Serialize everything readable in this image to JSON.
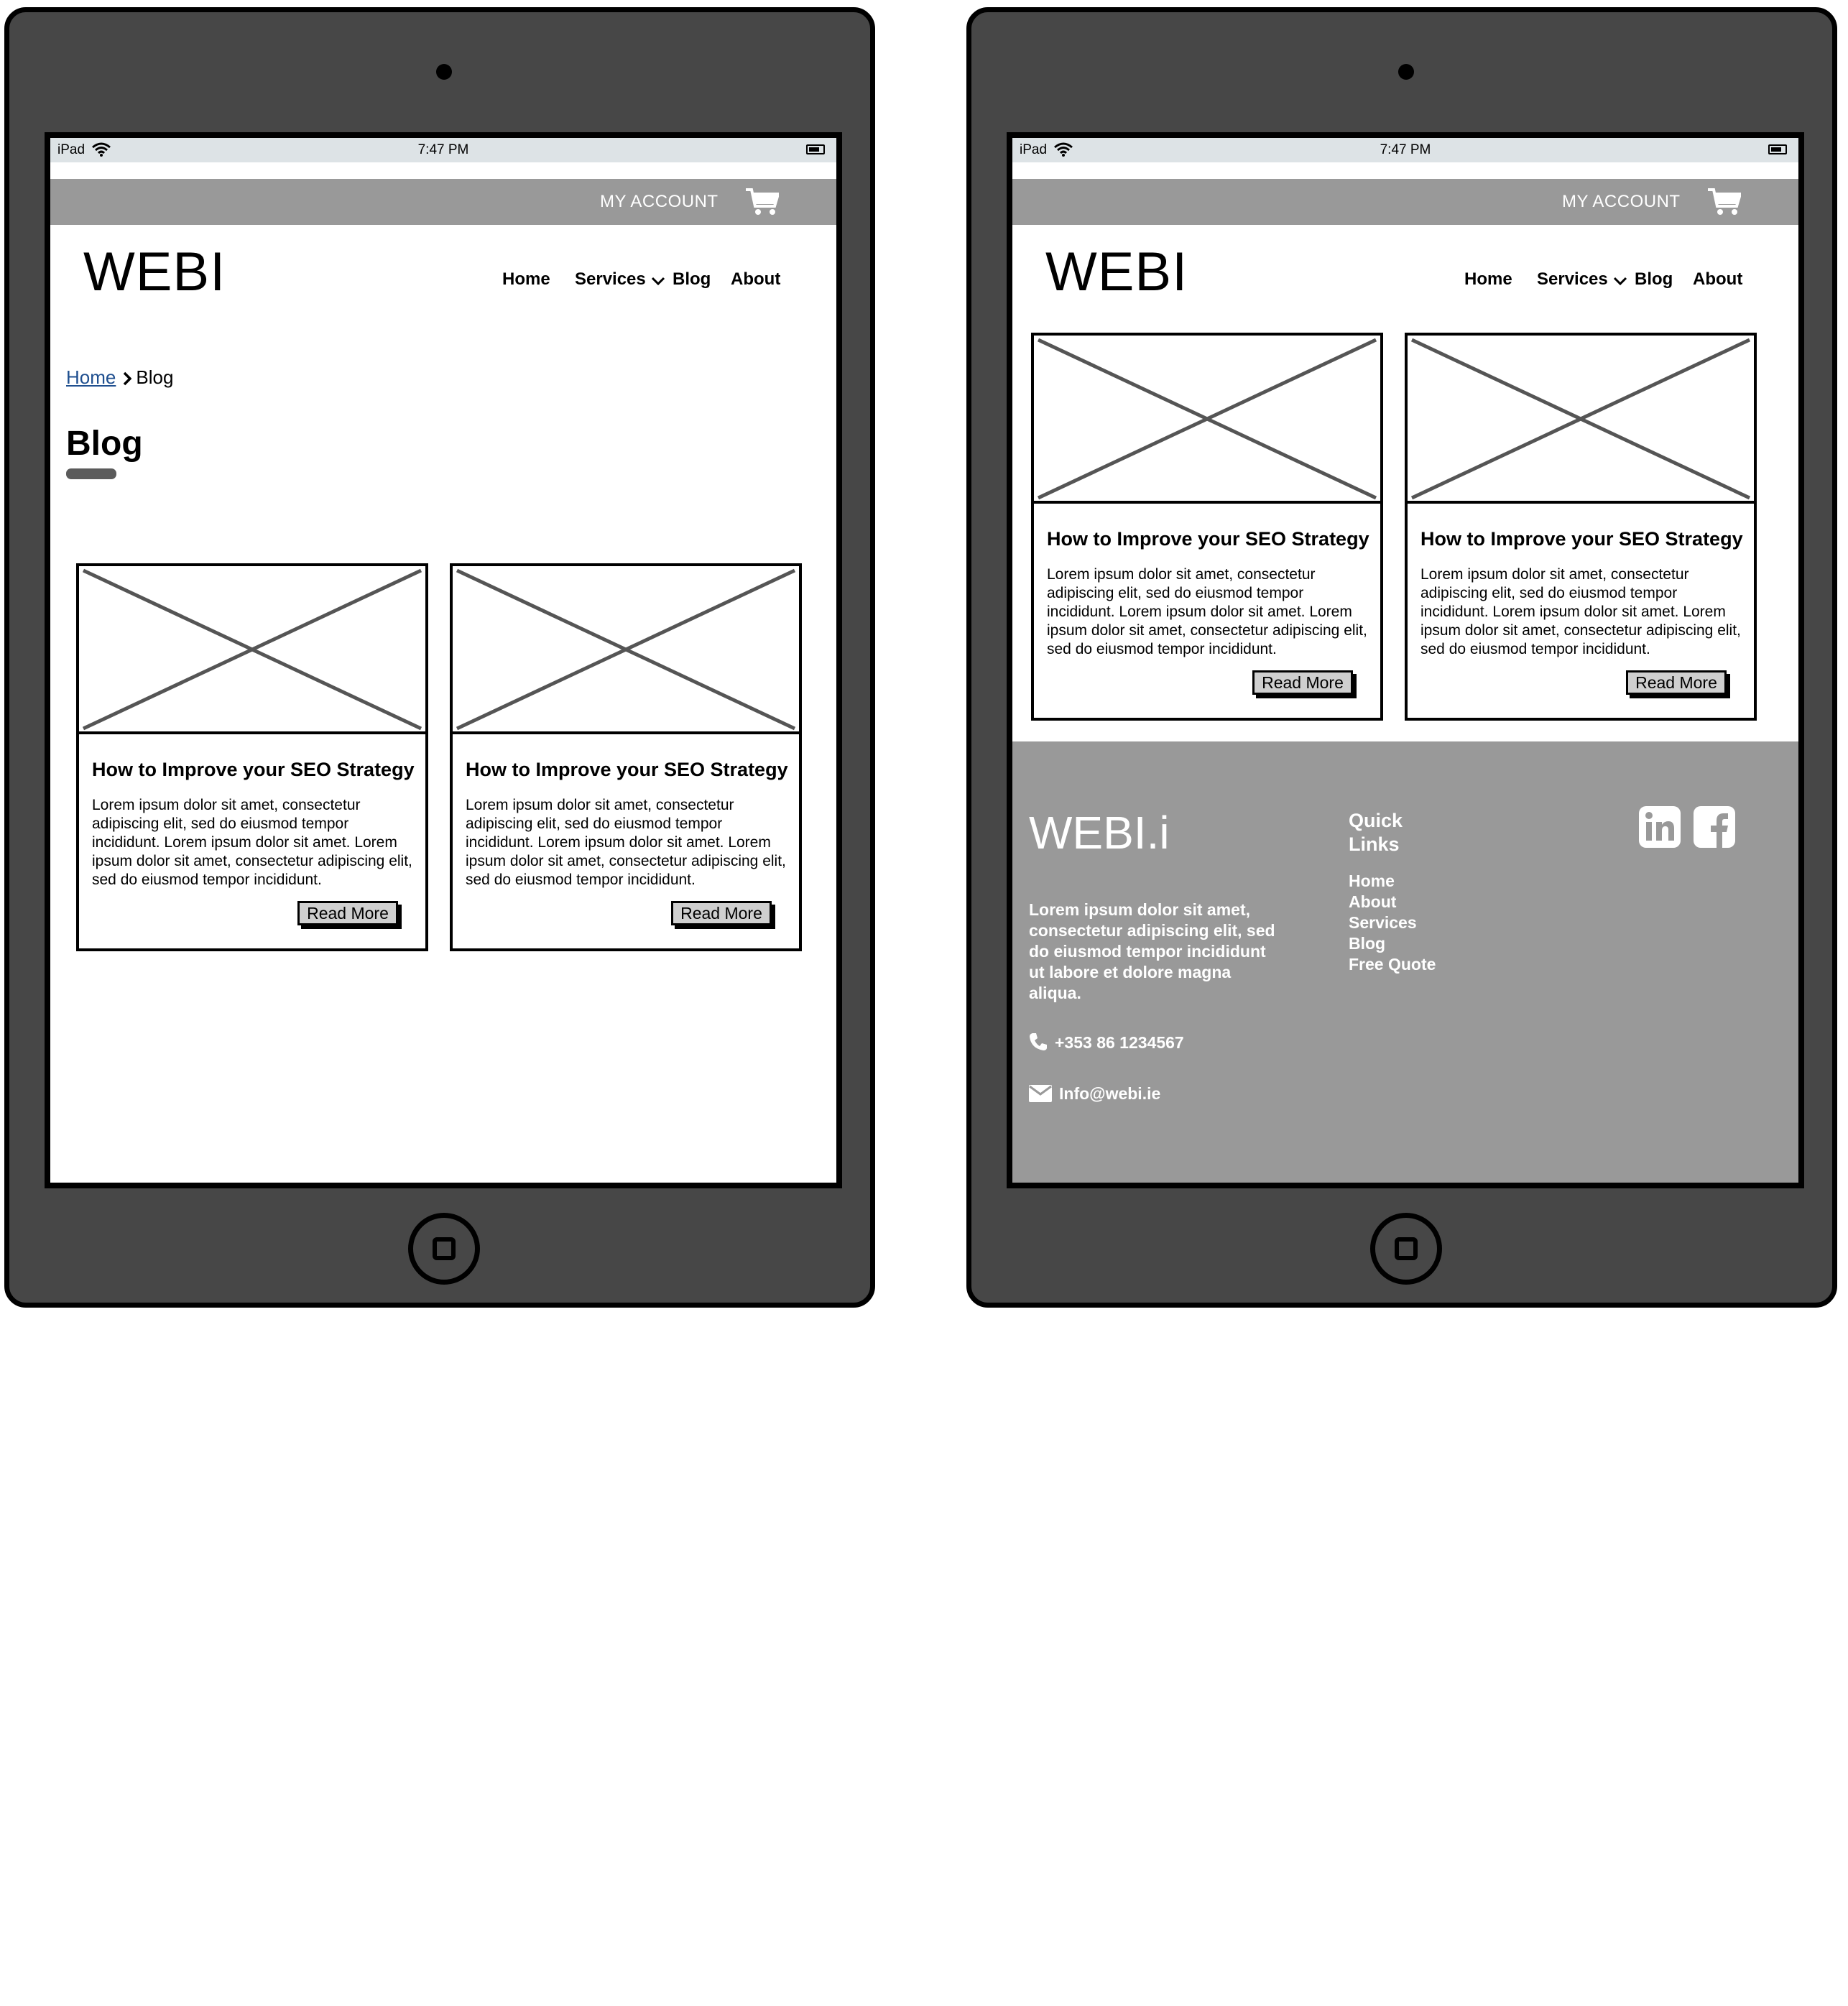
{
  "status_bar": {
    "carrier": "iPad",
    "time": "7:47 PM"
  },
  "header": {
    "account_label": "MY ACCOUNT",
    "cart_icon": "shopping-cart-icon",
    "logo": "WEBI",
    "nav": [
      "Home",
      "Services",
      "Blog",
      "About"
    ]
  },
  "breadcrumb": {
    "home": "Home",
    "current": "Blog"
  },
  "page_title": "Blog",
  "cards": [
    {
      "title": "How to Improve your SEO Strategy",
      "text": "Lorem ipsum dolor sit amet, consectetur adipiscing elit, sed do eiusmod tempor incididunt. Lorem ipsum dolor sit amet. Lorem ipsum dolor sit amet, consectetur adipiscing elit, sed do eiusmod tempor incididunt.",
      "button": "Read More"
    },
    {
      "title": "How to Improve your SEO Strategy",
      "text": "Lorem ipsum dolor sit amet, consectetur adipiscing elit, sed do eiusmod tempor incididunt. Lorem ipsum dolor sit amet. Lorem ipsum dolor sit amet, consectetur adipiscing elit, sed do eiusmod tempor incididunt.",
      "button": "Read More"
    }
  ],
  "footer": {
    "logo": "WEBI.i",
    "description": "Lorem ipsum dolor sit amet, consectetur adipiscing elit, sed do eiusmod tempor incididunt ut labore et dolore magna aliqua.",
    "phone": "+353 86 1234567",
    "email": "Info@webi.ie",
    "quick_links_title": "Quick Links",
    "quick_links": [
      "Home",
      "About",
      "Services",
      "Blog",
      "Free Quote"
    ],
    "social_icons": [
      "linkedin-icon",
      "facebook-icon"
    ]
  },
  "colors": {
    "device_body": "#474747",
    "status_bar": "#dde3e6",
    "header_bar": "#999999",
    "footer": "#999999",
    "link": "#1f4f8f",
    "button_bg": "#cfcfcf"
  }
}
